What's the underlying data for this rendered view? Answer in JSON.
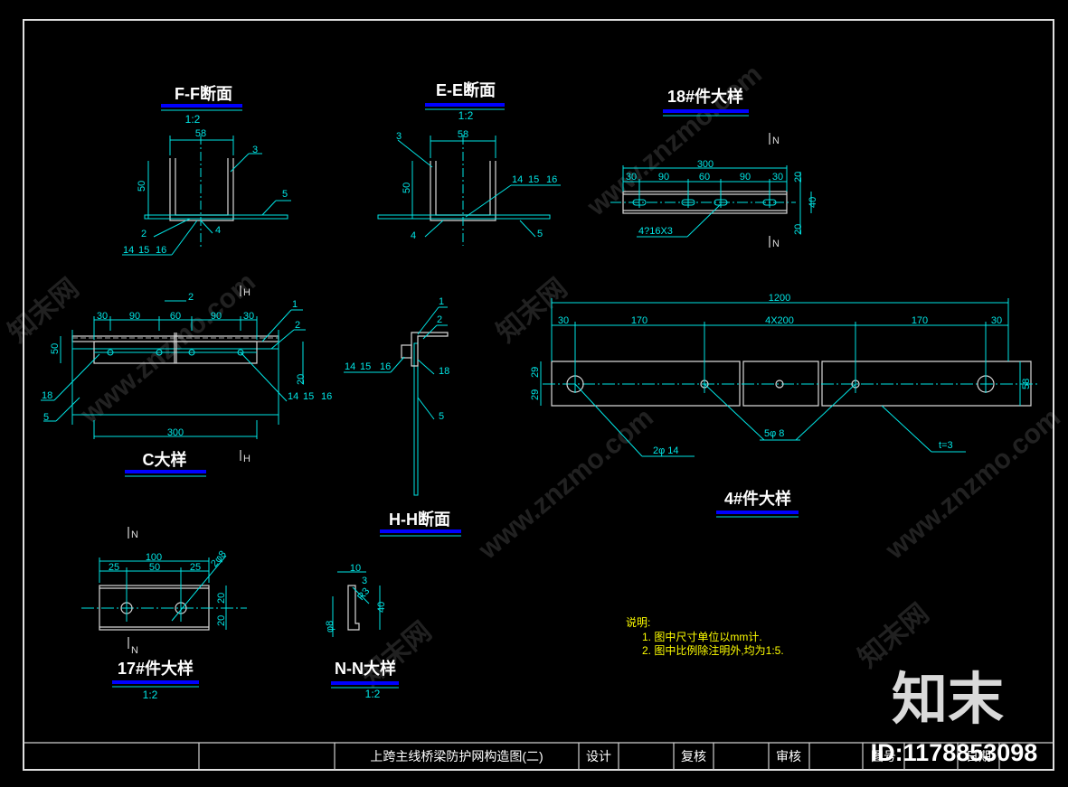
{
  "colors": {
    "line": "#00e5e5",
    "title": "#ffffff",
    "underline": "#0000ff",
    "notes": "#ffff00",
    "background": "#000000"
  },
  "views": {
    "ff": {
      "title": "F-F断面",
      "scale": "1:2",
      "labels": [
        "58",
        "50",
        "3",
        "5",
        "2",
        "4",
        "14",
        "15",
        "16"
      ]
    },
    "ee": {
      "title": "E-E断面",
      "scale": "1:2",
      "labels": [
        "58",
        "50",
        "3",
        "14",
        "15",
        "16",
        "4",
        "5"
      ]
    },
    "p18": {
      "title": "18#件大样",
      "labels": [
        "300",
        "30",
        "90",
        "60",
        "90",
        "30",
        "20",
        "40",
        "20",
        "4?16X3",
        "N",
        "N"
      ]
    },
    "c": {
      "title": "C大样",
      "labels": [
        "2",
        "30",
        "90",
        "60",
        "90",
        "30",
        "50",
        "20",
        "300",
        "1",
        "2",
        "18",
        "5",
        "14",
        "15",
        "16",
        "H",
        "H"
      ]
    },
    "hh": {
      "title": "H-H断面",
      "labels": [
        "1",
        "2",
        "14",
        "15",
        "16",
        "18",
        "5"
      ]
    },
    "p4": {
      "title": "4#件大样",
      "labels": [
        "1200",
        "30",
        "170",
        "4X200",
        "170",
        "30",
        "29",
        "29",
        "58",
        "2φ 14",
        "5φ 8",
        "t=3"
      ]
    },
    "p17": {
      "title": "17#件大样",
      "scale": "1:2",
      "labels": [
        "100",
        "25",
        "50",
        "25",
        "2φ8",
        "20",
        "20",
        "N",
        "N"
      ]
    },
    "nn": {
      "title": "N-N大样",
      "scale": "1:2",
      "labels": [
        "10",
        "3",
        "R3",
        "40",
        "φ8"
      ]
    }
  },
  "notes": {
    "heading": "说明:",
    "items": [
      "1.  图中尺寸单位以mm计.",
      "2.  图中比例除注明外,均为1:5."
    ]
  },
  "title_block": {
    "drawing_title": "上跨主线桥梁防护网构造图(二)",
    "design": "设计",
    "review": "复核",
    "approve": "审核",
    "drawing_no": "图号",
    "date": "日期"
  },
  "watermark": {
    "site": "www.znzmo.com",
    "brand": "知末网",
    "logo": "知末",
    "id": "ID:1178853098"
  }
}
